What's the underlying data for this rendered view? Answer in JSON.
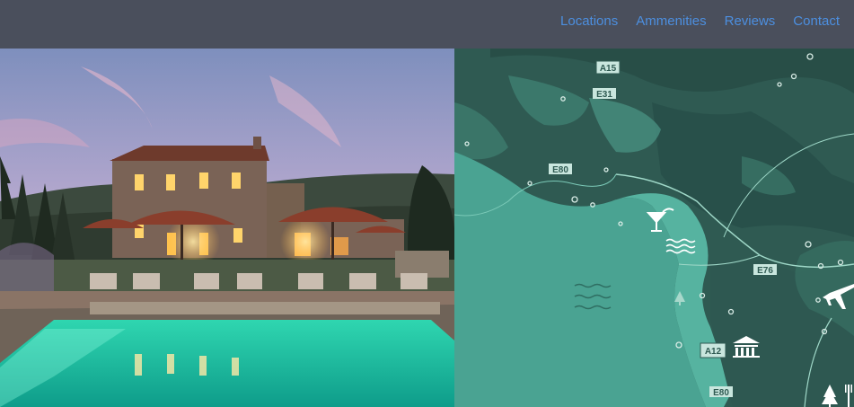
{
  "nav": {
    "links": [
      "Locations",
      "Ammenities",
      "Reviews",
      "Contact"
    ]
  },
  "map": {
    "road_labels": [
      "A15",
      "E31",
      "E80",
      "E76",
      "A12",
      "E80"
    ],
    "icons": [
      "cocktail-icon",
      "waves-icon",
      "sea-waves-icon",
      "pine-tree-icon",
      "museum-icon",
      "airplane-icon",
      "forest-icon",
      "restaurant-icon"
    ]
  },
  "colors": {
    "nav_bg": "#4a4f5c",
    "nav_link": "#4c8fe0",
    "sea": "#4aa392",
    "land": "#2f5a52",
    "highlight": "#56b3a0"
  }
}
